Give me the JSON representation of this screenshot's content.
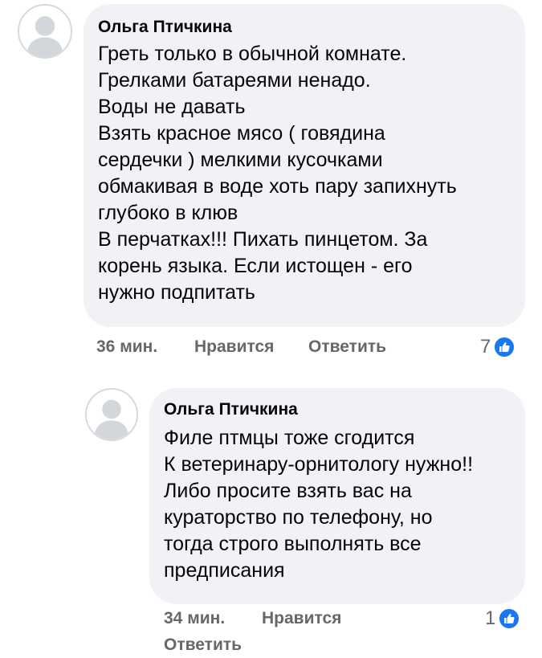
{
  "comments": [
    {
      "author": "Ольга Птичкина",
      "lines": [
        "Греть только в обычной комнате.",
        "Грелками батареями ненадо.",
        "Воды не давать",
        "Взять красное мясо ( говядина",
        "сердечки ) мелкими кусочками",
        "обмакивая в воде хоть пару запихнуть",
        "глубоко в клюв",
        "В перчатках!!! Пихать пинцетом. За",
        "корень языка. Если истощен - его",
        "нужно подпитать"
      ],
      "time": "36 мин.",
      "like_label": "Нравится",
      "reply_label": "Ответить",
      "reaction_count": "7"
    },
    {
      "author": "Ольга Птичкина",
      "lines": [
        "Филе птмцы тоже сгодится",
        "К ветеринару-орнитологу нужно!!",
        "Либо просите взять вас на",
        "кураторство по телефону, но",
        "тогда строго выполнять все",
        "предписания"
      ],
      "time": "34 мин.",
      "like_label": "Нравится",
      "reply_label": "Ответить",
      "reaction_count": "1"
    }
  ],
  "icons": {
    "avatar": "default-avatar-icon",
    "reaction": "like-reaction-icon"
  },
  "colors": {
    "bubble": "#f0f2f5",
    "text": "#050505",
    "meta": "#65676b",
    "like_blue": "#1877f2"
  }
}
